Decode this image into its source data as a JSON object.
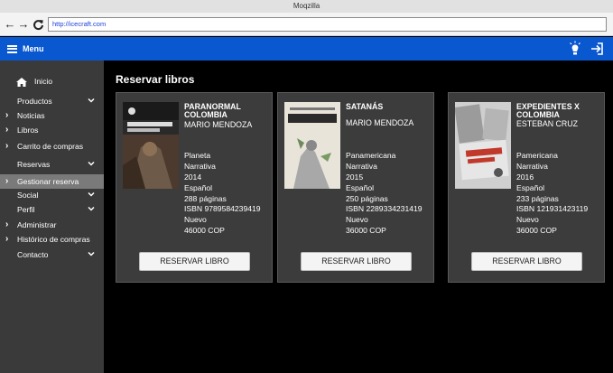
{
  "browser": {
    "title": "Moqzilla",
    "url": "http://icecraft.com"
  },
  "appbar": {
    "menu_label": "Menu",
    "icons": [
      "lightbulb-icon",
      "logout-icon"
    ]
  },
  "sidebar": {
    "items": [
      {
        "label": "Inicio",
        "icon": "home-icon"
      },
      {
        "label": "Productos",
        "icon": "chevron-down-icon"
      },
      {
        "label": "Noticias",
        "icon": "chevron-right-icon"
      },
      {
        "label": "Libros",
        "icon": "chevron-right-icon"
      },
      {
        "label": "Carrito de compras",
        "icon": "chevron-right-icon"
      },
      {
        "label": "Reservas",
        "icon": "chevron-down-icon"
      },
      {
        "label": "Gestionar reserva",
        "icon": "chevron-right-icon",
        "active": true
      },
      {
        "label": "Social",
        "icon": "chevron-down-icon"
      },
      {
        "label": "Perfil",
        "icon": "chevron-down-icon"
      },
      {
        "label": "Administrar",
        "icon": "chevron-right-icon"
      },
      {
        "label": "Histórico de compras",
        "icon": "chevron-right-icon"
      },
      {
        "label": "Contacto",
        "icon": "chevron-down-icon"
      }
    ]
  },
  "main": {
    "title": "Reservar libros",
    "button_label": "RESERVAR LIBRO",
    "books": [
      {
        "title_line1": "PARANORMAL",
        "title_line2": "COLOMBIA",
        "author": "MARIO MENDOZA",
        "publisher": "Planeta",
        "genre": "Narrativa",
        "year": "2014",
        "language": "Español",
        "pages": "288 páginas",
        "isbn": "ISBN 9789584239419",
        "condition": "Nuevo",
        "price": "46000 COP",
        "cover_text": "PARANORMAL COLOMBIA"
      },
      {
        "title_line1": "SATANÁS",
        "title_line2": "",
        "author": "MARIO MENDOZA",
        "publisher": "Panamericana",
        "genre": "Narrativa",
        "year": "2015",
        "language": "Español",
        "pages": "250 páginas",
        "isbn": "ISBN 2289334231419",
        "condition": "Nuevo",
        "price": "36000 COP",
        "cover_text": "SATANÁS",
        "cover_author": "MARIO MENDOZA"
      },
      {
        "title_line1": "EXPEDIENTES X",
        "title_line2": "COLOMBIA",
        "author": "ESTEBAN CRUZ",
        "publisher": "Pamericana",
        "genre": "Narrativa",
        "year": "2016",
        "language": "Español",
        "pages": "233 páginas",
        "isbn": "ISBN 121931423119",
        "condition": "Nuevo",
        "price": "36000 COP",
        "cover_text": "EXPEDIENTES X COLOMBIA"
      }
    ]
  },
  "colors": {
    "appbar": "#0a58d0",
    "sidebar": "#3a3a3a",
    "sidebar_active": "#7a7a7a",
    "card": "#3c3c3c",
    "main_bg": "#000000"
  }
}
